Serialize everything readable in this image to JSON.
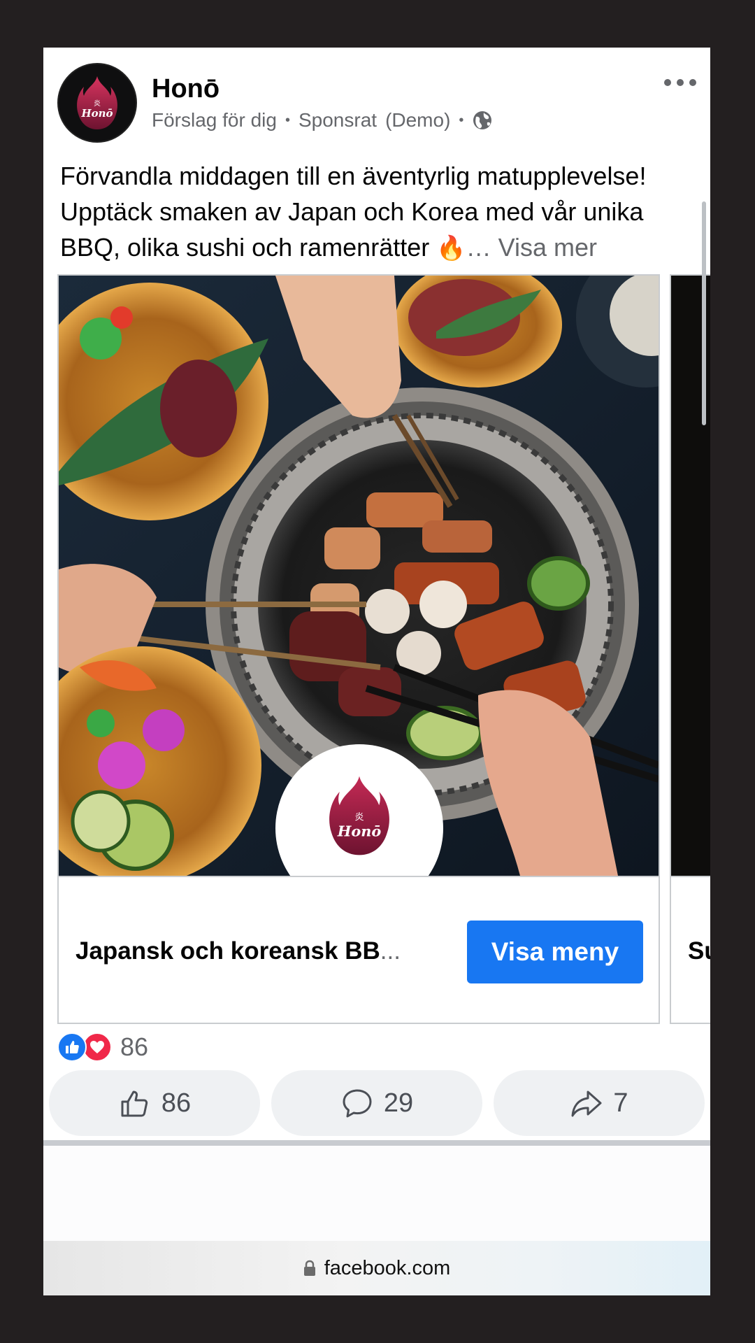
{
  "post": {
    "page_name": "Honō",
    "meta": {
      "suggested": "Förslag för dig",
      "sponsored": "Sponsrat",
      "demo": "(Demo)"
    },
    "caption": "Förvandla middagen till en äventyrlig matupplevelse! Upptäck smaken av Japan och Korea med vår unika BBQ, olika sushi och ramenrätter",
    "caption_emoji": "🔥",
    "see_more": "… Visa mer"
  },
  "logo": {
    "kanji": "炎",
    "wordmark": "Honō"
  },
  "carousel": {
    "cards": [
      {
        "title": "Japansk och koreansk BB",
        "title_ellipsis": "...",
        "cta": "Visa meny"
      },
      {
        "title": "Su"
      }
    ]
  },
  "engagement": {
    "reactions_count": "86",
    "like_count": "86",
    "comment_count": "29",
    "share_count": "7"
  },
  "browser": {
    "url": "facebook.com"
  },
  "colors": {
    "accent": "#1877f2",
    "love": "#f02849",
    "logo_flame": "#8e1b3d"
  },
  "icons": [
    "more-icon",
    "globe-icon",
    "like-reaction-icon",
    "love-reaction-icon",
    "thumbs-up-icon",
    "comment-icon",
    "share-icon",
    "lock-icon",
    "flame-logo-icon"
  ]
}
